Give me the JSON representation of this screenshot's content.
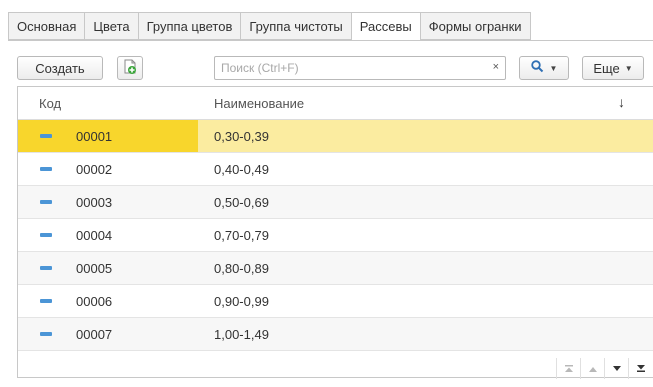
{
  "tabs": [
    {
      "label": "Основная",
      "active": false
    },
    {
      "label": "Цвета",
      "active": false
    },
    {
      "label": "Группа цветов",
      "active": false
    },
    {
      "label": "Группа чистоты",
      "active": false
    },
    {
      "label": "Рассевы",
      "active": true
    },
    {
      "label": "Формы огранки",
      "active": false
    }
  ],
  "toolbar": {
    "create_label": "Создать",
    "search_placeholder": "Поиск (Ctrl+F)",
    "search_clear": "×",
    "more_label": "Еще",
    "icons": [
      "add-document-icon",
      "search-icon",
      "dropdown-caret-icon"
    ]
  },
  "table": {
    "columns": {
      "code": "Код",
      "name": "Наименование",
      "sort_indicator": "↓"
    },
    "rows": [
      {
        "code": "00001",
        "name": "0,30-0,39",
        "selected": true
      },
      {
        "code": "00002",
        "name": "0,40-0,49",
        "selected": false
      },
      {
        "code": "00003",
        "name": "0,50-0,69",
        "selected": false
      },
      {
        "code": "00004",
        "name": "0,70-0,79",
        "selected": false
      },
      {
        "code": "00005",
        "name": "0,80-0,89",
        "selected": false
      },
      {
        "code": "00006",
        "name": "0,90-0,99",
        "selected": false
      },
      {
        "code": "00007",
        "name": "1,00-1,49",
        "selected": false
      }
    ]
  },
  "colors": {
    "selected_row": "#fbeca0",
    "selected_cell": "#f8d62c",
    "row_marker": "#4b95d6",
    "add_icon_green": "#3aa53a"
  }
}
